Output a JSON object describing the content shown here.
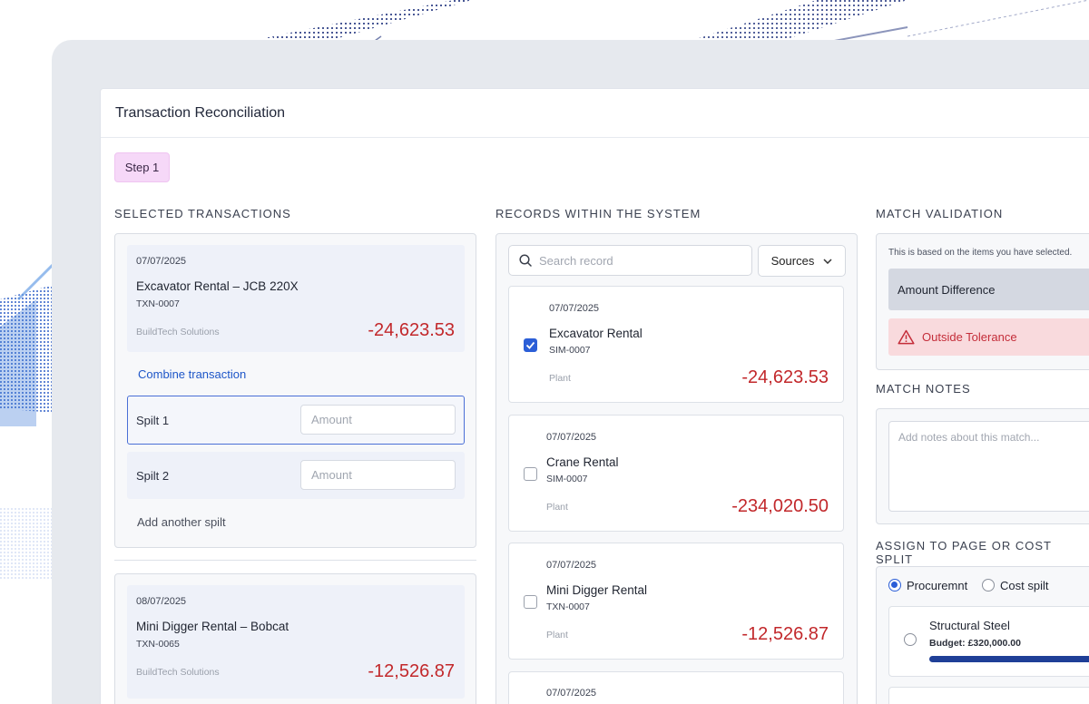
{
  "window": {
    "title": "Transaction Reconciliation",
    "step": "Step 1"
  },
  "colors": {
    "accent": "#2b5ed7",
    "negative": "#c2282b",
    "step_badge": "#f6d8f8",
    "warning_bg": "#f9dadd"
  },
  "selected": {
    "heading": "SELECTED TRANSACTIONS",
    "transactions": [
      {
        "date": "07/07/2025",
        "name": "Excavator Rental – JCB 220X",
        "code": "TXN-0007",
        "vendor": "BuildTech Solutions",
        "amount": "-24,623.53"
      },
      {
        "date": "08/07/2025",
        "name": "Mini Digger Rental – Bobcat",
        "code": "TXN-0065",
        "vendor": "BuildTech Solutions",
        "amount": "-12,526.87"
      }
    ],
    "combine_label": "Combine transaction",
    "splits": [
      {
        "label": "Spilt 1",
        "placeholder": "Amount"
      },
      {
        "label": "Spilt 2",
        "placeholder": "Amount"
      }
    ],
    "add_split_label": "Add another spilt"
  },
  "records": {
    "heading": "RECORDS WITHIN THE SYSTEM",
    "search_placeholder": "Search record",
    "sources_label": "Sources",
    "items": [
      {
        "date": "07/07/2025",
        "name": "Excavator Rental",
        "code": "SIM-0007",
        "category": "Plant",
        "amount": "-24,623.53",
        "checked": true
      },
      {
        "date": "07/07/2025",
        "name": "Crane Rental",
        "code": "SIM-0007",
        "category": "Plant",
        "amount": "-234,020.50",
        "checked": false
      },
      {
        "date": "07/07/2025",
        "name": "Mini Digger Rental",
        "code": "TXN-0007",
        "category": "Plant",
        "amount": "-12,526.87",
        "checked": false
      },
      {
        "date": "07/07/2025"
      }
    ]
  },
  "validation": {
    "heading": "MATCH VALIDATION",
    "note": "This is based on the items you have selected.",
    "amount_difference_label": "Amount Difference",
    "tolerance_label": "Outside Tolerance"
  },
  "notes": {
    "heading": "MATCH NOTES",
    "placeholder": "Add notes about this match..."
  },
  "assign": {
    "heading": "ASSIGN TO PAGE OR COST SPLIT",
    "options": [
      "Procuremnt",
      "Cost spilt"
    ],
    "selected_option": "Procuremnt",
    "item": {
      "name": "Structural Steel",
      "budget": "Budget: £320,000.00"
    }
  }
}
